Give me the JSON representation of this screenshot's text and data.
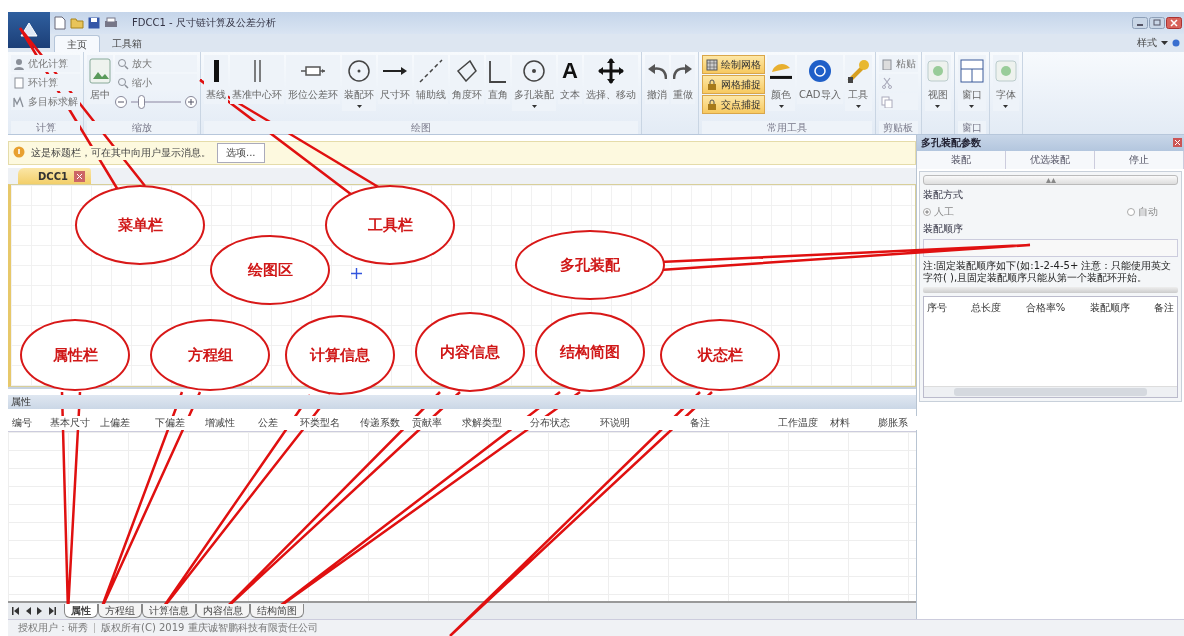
{
  "window": {
    "title": "FDCC1 - 尺寸链计算及公差分析"
  },
  "ribbon_tabs": [
    {
      "label": "主页",
      "selected": true
    },
    {
      "label": "工具箱",
      "selected": false
    }
  ],
  "style_menu": {
    "label": "样式"
  },
  "ribbon_groups": [
    {
      "title": "计算",
      "items": [
        {
          "kind": "small",
          "label": "优化计算"
        },
        {
          "kind": "small",
          "label": "环计算"
        },
        {
          "kind": "small",
          "label": "多目标求解"
        }
      ]
    },
    {
      "title": "缩放",
      "items": [
        {
          "kind": "large",
          "label": "居中",
          "dropdown": false
        },
        {
          "kind": "small",
          "label": "放大"
        },
        {
          "kind": "small",
          "label": "缩小"
        },
        {
          "kind": "zoom",
          "level": 0.2
        }
      ]
    },
    {
      "title": "绘图",
      "items": [
        {
          "kind": "large",
          "label": "基线",
          "dropdown": false
        },
        {
          "kind": "large",
          "label": "基准中心环",
          "dropdown": false
        },
        {
          "kind": "large",
          "label": "形位公差环",
          "dropdown": false
        },
        {
          "kind": "large",
          "label": "装配环",
          "dropdown": true
        },
        {
          "kind": "large",
          "label": "尺寸环",
          "dropdown": false
        },
        {
          "kind": "large",
          "label": "辅助线",
          "dropdown": false
        },
        {
          "kind": "large",
          "label": "角度环",
          "dropdown": false
        },
        {
          "kind": "large",
          "label": "直角",
          "dropdown": false
        },
        {
          "kind": "large",
          "label": "多孔装配",
          "dropdown": true
        },
        {
          "kind": "glyph",
          "glyph": "A",
          "label": "文本"
        },
        {
          "kind": "large",
          "label": "选择、移动",
          "dropdown": false
        }
      ]
    },
    {
      "items": [
        {
          "kind": "large",
          "label": "撤消",
          "dropdown": false
        },
        {
          "kind": "large",
          "label": "重做",
          "dropdown": false
        }
      ]
    },
    {
      "title": "常用工具",
      "items": [
        {
          "kind": "toggle",
          "label": "绘制网格",
          "on": true
        },
        {
          "kind": "toggle",
          "label": "网格捕捉",
          "on": true
        },
        {
          "kind": "toggle",
          "label": "交点捕捉",
          "on": true
        },
        {
          "kind": "large",
          "label": "颜色",
          "dropdown": true
        },
        {
          "kind": "large",
          "label": "CAD导入",
          "dropdown": false
        },
        {
          "kind": "large",
          "label": "工具",
          "dropdown": true
        }
      ]
    },
    {
      "title": "剪贴板",
      "items": [
        {
          "kind": "small",
          "label": "粘贴"
        },
        {
          "kind": "icon"
        },
        {
          "kind": "icon"
        }
      ]
    },
    {
      "items": [
        {
          "kind": "large",
          "label": "视图",
          "dropdown": true
        }
      ]
    },
    {
      "title": "窗口",
      "items": [
        {
          "kind": "large",
          "label": "窗口",
          "dropdown": true
        }
      ]
    },
    {
      "items": [
        {
          "kind": "large",
          "label": "字体",
          "dropdown": true
        }
      ]
    }
  ],
  "message_bar": {
    "text": "这是标题栏，可在其中向用户显示消息。",
    "button": "选项..."
  },
  "document_tab": {
    "label": "DCC1"
  },
  "properties": {
    "title": "属性",
    "columns": [
      "编号",
      "基本尺寸",
      "上偏差",
      "下偏差",
      "增减性",
      "公差",
      "环类型名",
      "传递系数",
      "贡献率",
      "求解类型",
      "分布状态",
      "环说明",
      "备注",
      "工作温度",
      "材料",
      "膨胀系"
    ]
  },
  "bottom_tabs": [
    {
      "label": "属性",
      "selected": true
    },
    {
      "label": "方程组",
      "selected": false
    },
    {
      "label": "计算信息",
      "selected": false
    },
    {
      "label": "内容信息",
      "selected": false
    },
    {
      "label": "结构简图",
      "selected": false
    }
  ],
  "status_bar": {
    "user": "授权用户：研秀",
    "copyright": "版权所有(C) 2019 重庆诚智鹏科技有限责任公司"
  },
  "assembly_panel": {
    "title": "多孔装配参数",
    "buttons": [
      "装配",
      "优选装配",
      "停止"
    ],
    "mode_label": "装配方式",
    "modes": [
      {
        "label": "人工",
        "selected": true
      },
      {
        "label": "自动",
        "selected": false
      }
    ],
    "order_label": "装配顺序",
    "note": "注:固定装配顺序如下(如:1-2-4-5+ 注意：只能使用英文字符( ),且固定装配顺序只能从第一个装配环开始。",
    "columns": [
      "序号",
      "总长度",
      "合格率%",
      "装配顺序",
      "备注"
    ]
  },
  "callouts": [
    {
      "label": "菜单栏"
    },
    {
      "label": "工具栏"
    },
    {
      "label": "绘图区"
    },
    {
      "label": "多孔装配"
    },
    {
      "label": "属性栏"
    },
    {
      "label": "方程组"
    },
    {
      "label": "计算信息"
    },
    {
      "label": "内容信息"
    },
    {
      "label": "结构简图"
    },
    {
      "label": "状态栏"
    }
  ]
}
